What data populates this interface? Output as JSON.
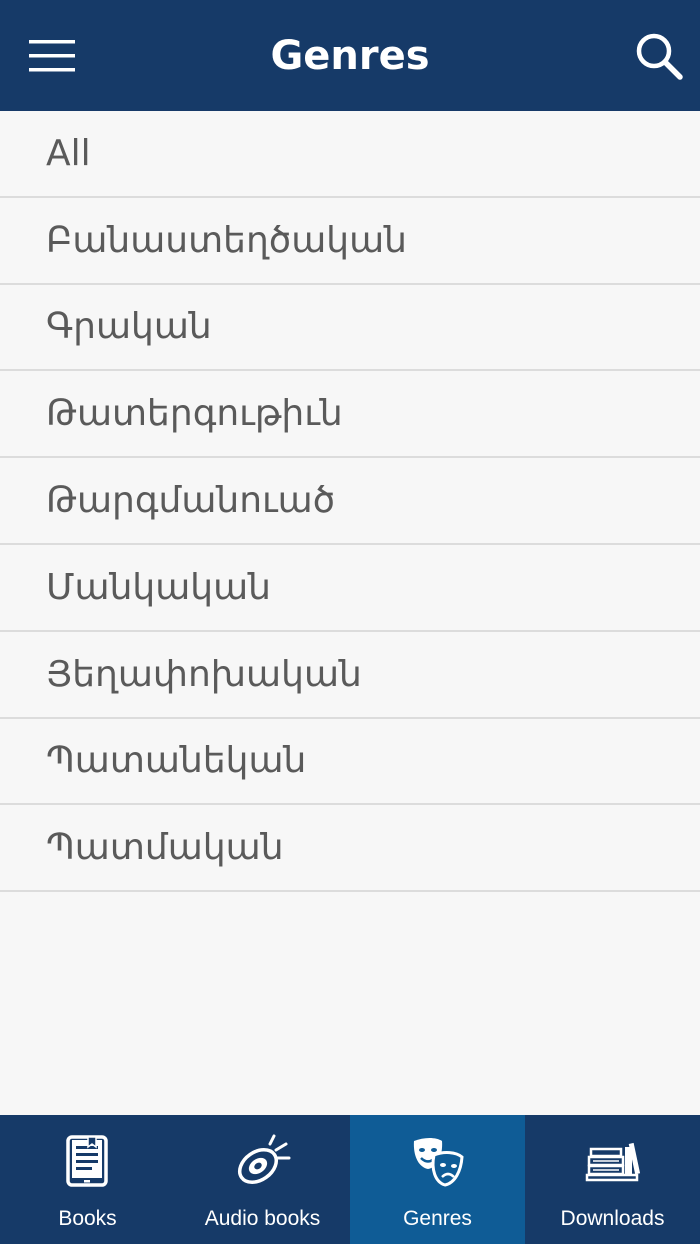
{
  "header": {
    "title": "Genres",
    "menu_icon": "hamburger-menu-icon",
    "search_icon": "search-icon",
    "background": "#163a68"
  },
  "genres": [
    "All",
    "Բանաստեղծական",
    "Գրական",
    "Թատերգութիւն",
    "Թարգմանուած",
    "Մանկական",
    "Յեղափոխական",
    "Պատանեկան",
    "Պատմական"
  ],
  "tabs": [
    {
      "label": "Books",
      "icon": "book-icon",
      "active": false
    },
    {
      "label": "Audio books",
      "icon": "speaker-icon",
      "active": false
    },
    {
      "label": "Genres",
      "icon": "theater-masks-icon",
      "active": true
    },
    {
      "label": "Downloads",
      "icon": "bookshelf-icon",
      "active": false
    }
  ],
  "colors": {
    "tab_bar": "#163a68",
    "tab_active": "#0f5c96",
    "list_text": "#5a5a5a",
    "divider": "#dcdcdc"
  }
}
